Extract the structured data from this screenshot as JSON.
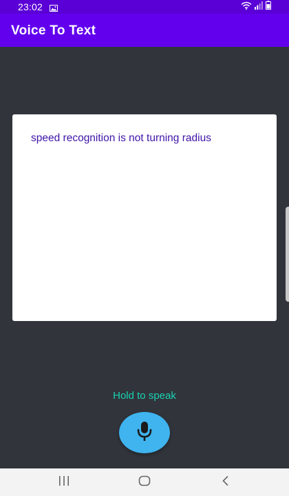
{
  "status_bar": {
    "time": "23:02",
    "icons": [
      "gallery-icon",
      "wifi-icon",
      "signal-icon",
      "battery-icon"
    ]
  },
  "app_bar": {
    "title": "Voice To Text",
    "color": "#6200ee"
  },
  "transcript": {
    "text": "speed recognition is not turning radius",
    "text_color": "#3f14a8"
  },
  "hint": {
    "label": "Hold to speak",
    "color": "#18d3b3"
  },
  "mic_button": {
    "icon": "microphone-icon",
    "color": "#3fb4ef"
  },
  "nav_bar": {
    "buttons": [
      "recent-apps-icon",
      "home-icon",
      "back-icon"
    ]
  },
  "colors": {
    "background": "#31343b",
    "status_bar": "#5a00d6"
  }
}
